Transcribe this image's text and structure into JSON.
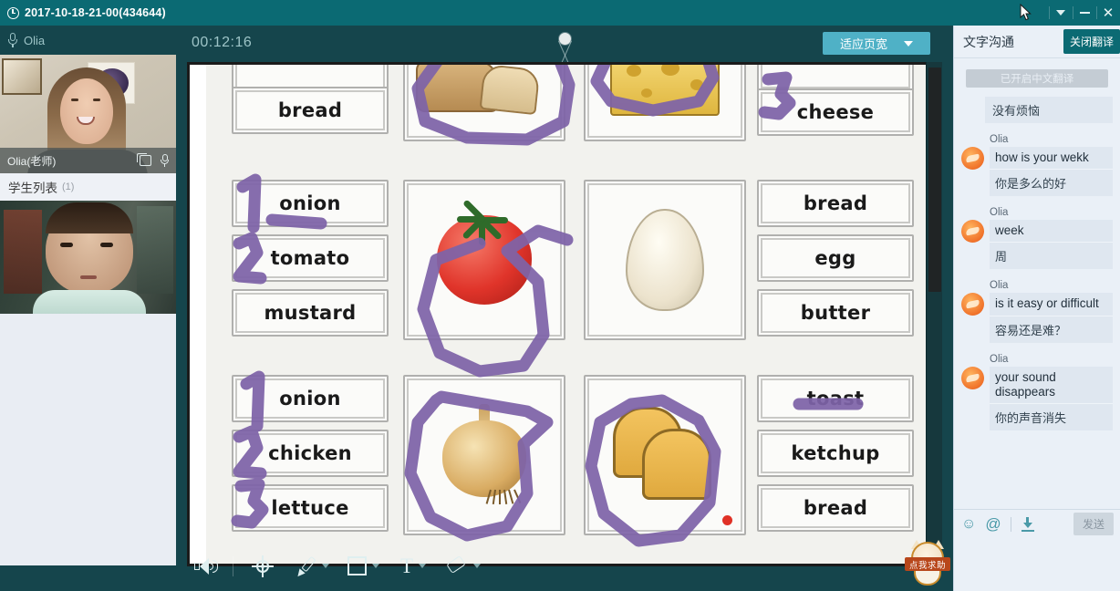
{
  "titlebar": {
    "clock_icon": "clock-icon",
    "title": "2017-10-18-21-00(434644)",
    "caret_icon": "chevron-down-icon",
    "minimize_icon": "minimize-icon",
    "close_icon": "close-icon"
  },
  "left_panel": {
    "mic_icon": "microphone-icon",
    "mic_label": "Olia",
    "teacher_card": {
      "name": "Olia(老师)",
      "popout_icon": "popout-window-icon",
      "mic_icon": "microphone-icon"
    },
    "student_list": {
      "label": "学生列表",
      "count": "(1)"
    }
  },
  "whiteboard_toolbar": {
    "elapsed_time": "00:12:16",
    "marker_icon": "page-marker-handle",
    "fit_button": "适应页宽",
    "fit_caret_icon": "chevron-down-icon"
  },
  "whiteboard": {
    "ibeam_icon": "text-cursor-icon",
    "scrollbar": "vertical-scrollbar",
    "worksheet": {
      "rows": [
        {
          "labels_left": [
            "bread"
          ],
          "picture_left": "bread-loaf-and-slice",
          "picture_right": "cheese-block",
          "labels_right": [
            "cheese"
          ],
          "number_annotation_right": "3"
        },
        {
          "labels_left": [
            "onion",
            "tomato",
            "mustard"
          ],
          "numbers_left": [
            "1",
            "2"
          ],
          "picture_left": "tomato",
          "picture_right": "egg",
          "labels_right": [
            "bread",
            "egg",
            "butter"
          ]
        },
        {
          "labels_left": [
            "onion",
            "chicken",
            "lettuce"
          ],
          "numbers_left": [
            "1",
            "2",
            "3"
          ],
          "picture_left": "onion",
          "picture_right": "toast-slices",
          "labels_right": [
            "toast",
            "ketchup",
            "bread"
          ]
        }
      ],
      "ink_color": "#7e63a8",
      "red_dot_color": "#e03126"
    }
  },
  "bottom_toolbar": {
    "tools": [
      {
        "name": "sound-icon",
        "label": ""
      },
      {
        "name": "pointer-target-icon",
        "label": ""
      },
      {
        "name": "pencil-icon",
        "label": ""
      },
      {
        "name": "rectangle-icon",
        "label": ""
      },
      {
        "name": "text-tool-icon",
        "label": "T"
      },
      {
        "name": "eraser-icon",
        "label": ""
      }
    ],
    "mascot_label": "点我求助"
  },
  "chat": {
    "title": "文字沟通",
    "translate_button": "关闭翻译",
    "system_notice": "已开启中文翻译",
    "standalone_message": "没有烦恼",
    "messages": [
      {
        "sender": "Olia",
        "en": "how is your wekk",
        "zh": "你是多么的好"
      },
      {
        "sender": "Olia",
        "en": "week",
        "zh": "周"
      },
      {
        "sender": "Olia",
        "en": "is it easy or difficult",
        "zh": "容易还是难？"
      },
      {
        "sender": "Olia",
        "en": "your sound disappears",
        "zh": "你的声音消失"
      }
    ],
    "footer": {
      "emoji_icon": "emoji-icon",
      "at_icon": "at-mention-icon",
      "download_icon": "download-icon",
      "send_button": "发送"
    }
  },
  "colors": {
    "titlebar": "#0b6a73",
    "app_dark": "#15454c",
    "accent_button": "#4fb1c6",
    "chat_bg": "#eaf0f7",
    "ink_purple": "#7e63a8"
  }
}
